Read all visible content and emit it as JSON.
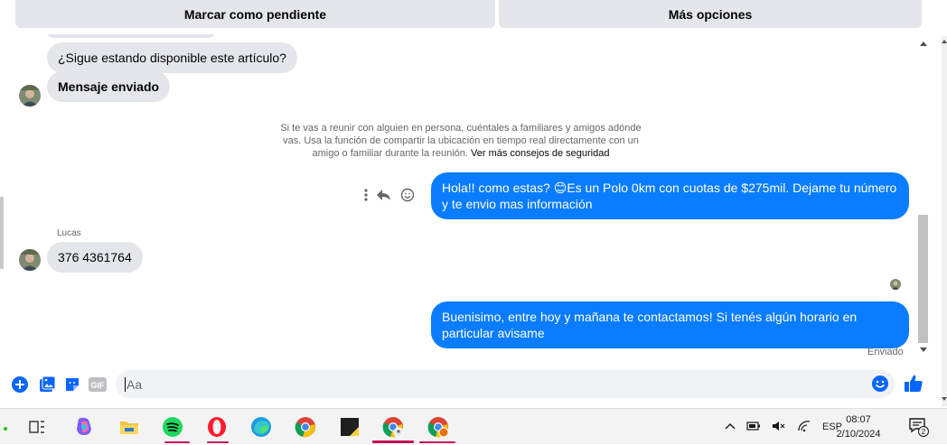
{
  "top_buttons": {
    "mark_pending": "Marcar como pendiente",
    "more_options": "Más opciones"
  },
  "messages": {
    "incoming_1": "¿Sigue estando disponible este artículo?",
    "incoming_2": "Mensaje enviado",
    "notice_text": "Si te vas a reunir con alguien en persona, cuéntales a familiares y amigos adónde vas. Usa la función de compartir la ubicación en tiempo real directamente con un amigo o familiar durante la reunión.",
    "notice_link": "Ver más consejos de seguridad",
    "outgoing_1": "Hola!! como estas? 😊Es un Polo 0km con cuotas de $275mil. Dejame tu número y te envio mas información",
    "sender_name": "Lucas",
    "incoming_3": "376 4361764",
    "outgoing_2": "Buenisimo, entre hoy y mañana te contactamos! Si tenés algún horario en particular avisame",
    "status": "Enviado"
  },
  "composer": {
    "placeholder": "Aa"
  },
  "taskbar": {
    "language": "ESP",
    "time": "08:07",
    "date": "2/10/2024",
    "notification_count": "2"
  },
  "colors": {
    "outgoing_bubble": "#0a7cff",
    "incoming_bubble": "#e4e6eb",
    "accent_icon": "#0866ff"
  }
}
